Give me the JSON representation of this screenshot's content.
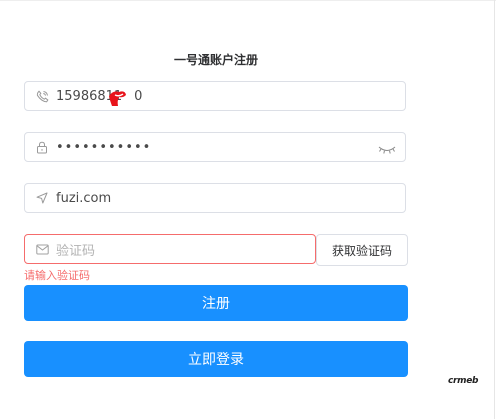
{
  "form": {
    "title": "一号通账户注册",
    "phone": {
      "value": "15986811",
      "value_tail": "0",
      "icon": "phone-icon"
    },
    "password": {
      "masked": "•••••••••••",
      "icon": "lock-icon",
      "toggle_icon": "eye-closed-icon"
    },
    "domain": {
      "value": "fuzi.com",
      "icon": "location-arrow-icon"
    },
    "code": {
      "placeholder": "验证码",
      "icon": "mail-icon"
    },
    "get_code_label": "获取验证码",
    "error_text": "请输入验证码",
    "register_label": "注册",
    "login_label": "立即登录"
  },
  "brand": {
    "logo_text": "crmeb"
  },
  "colors": {
    "primary": "#1890ff",
    "error": "#f56c6c",
    "border": "#dcdfe6"
  }
}
